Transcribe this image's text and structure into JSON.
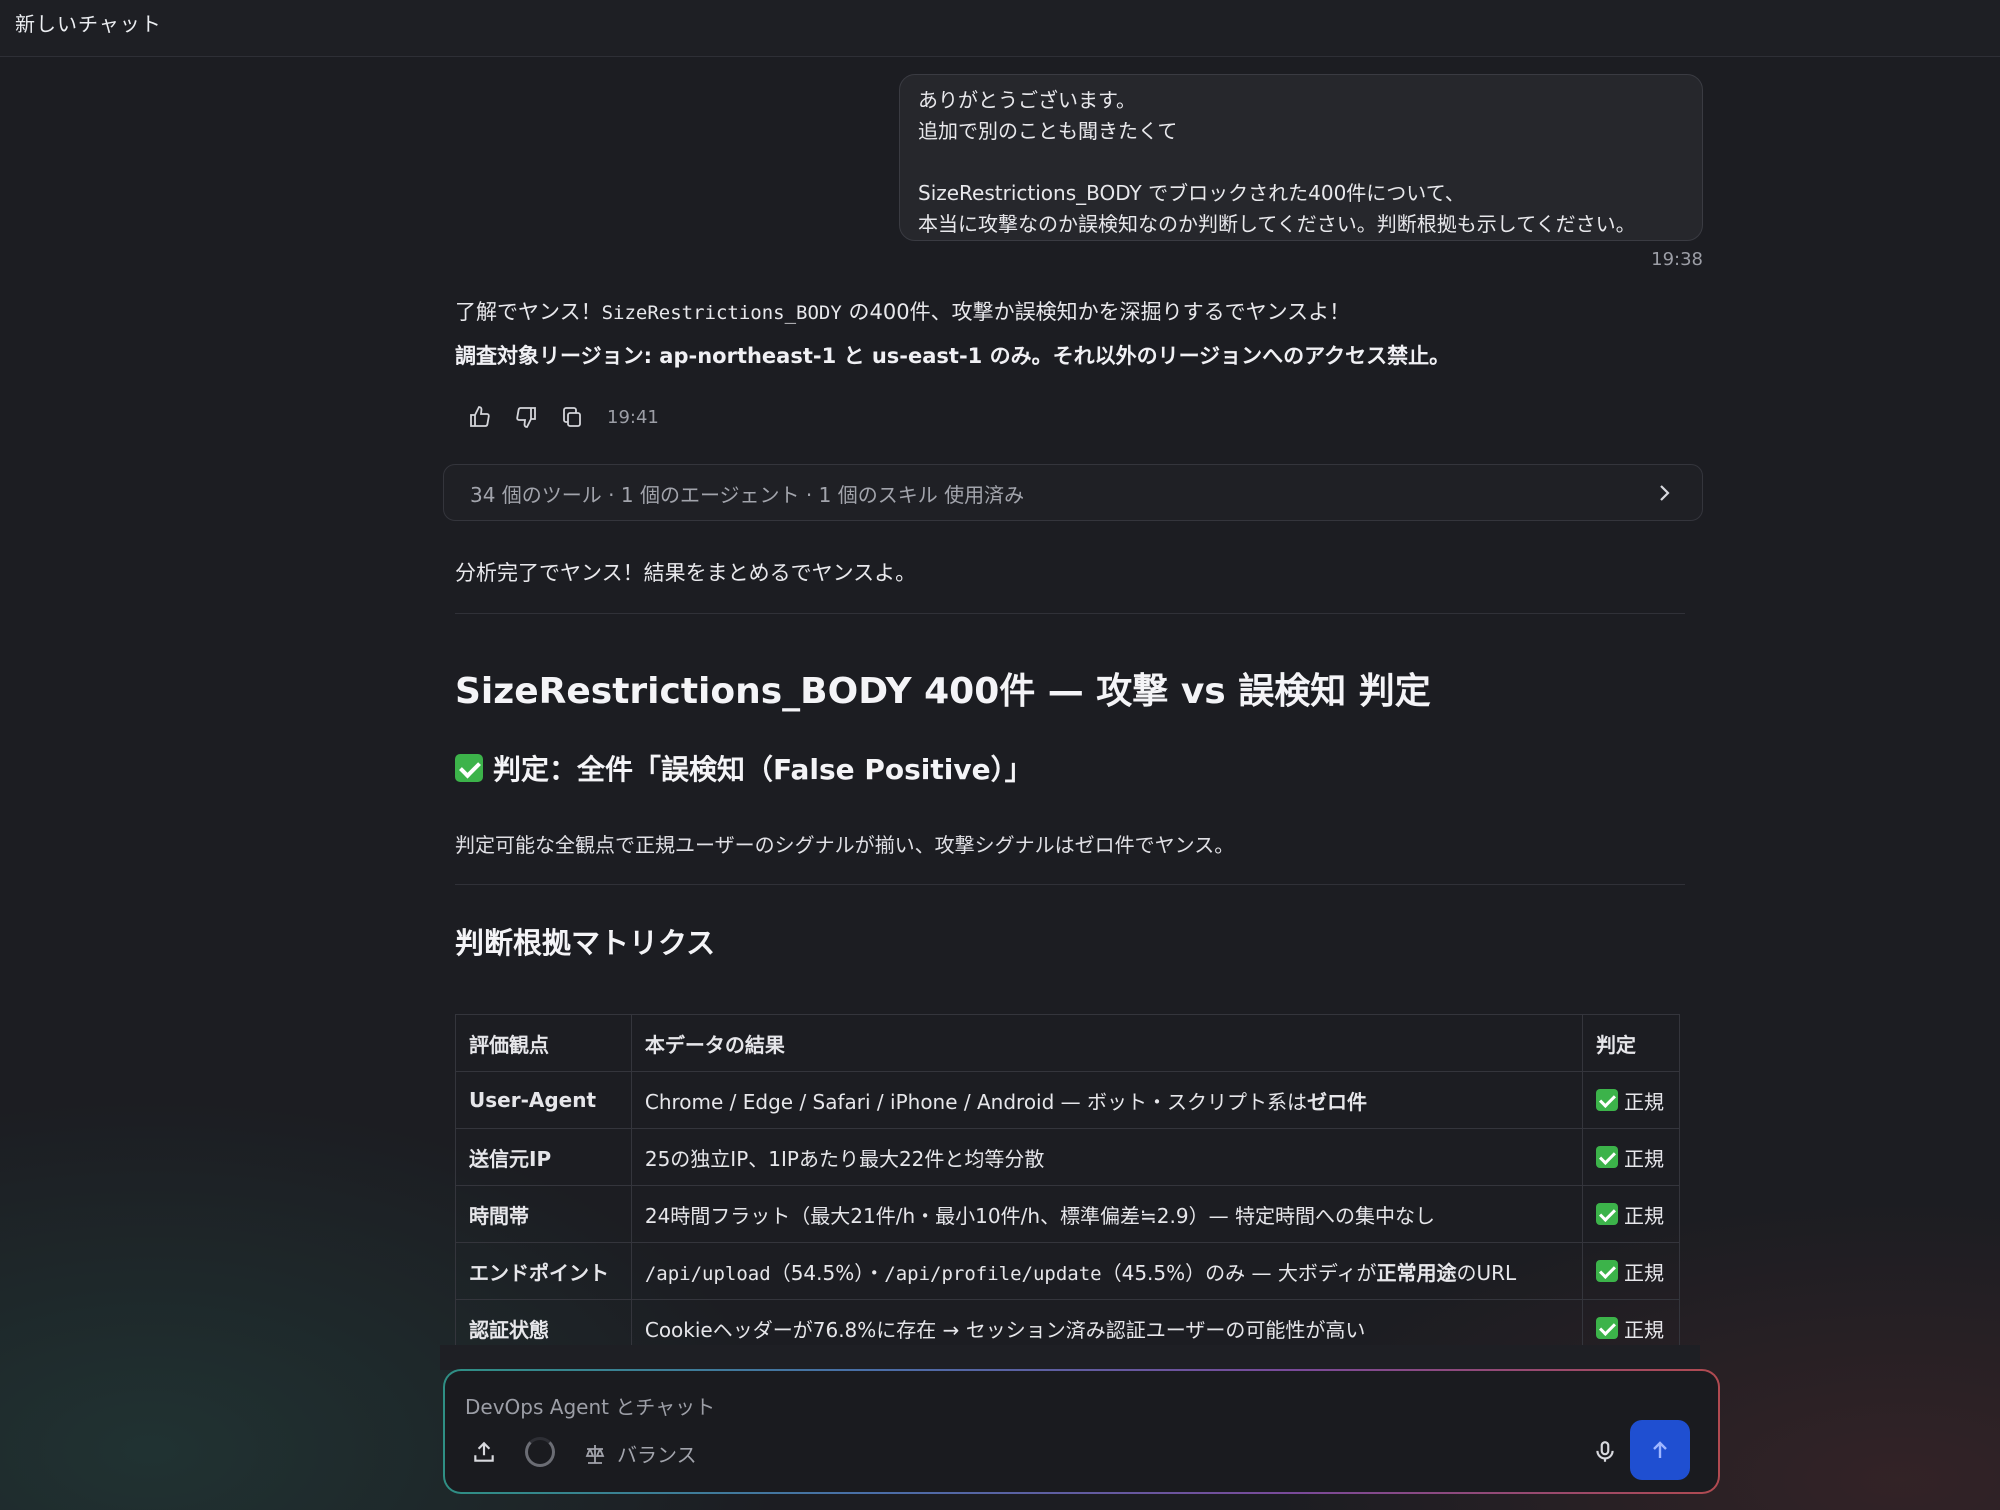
{
  "header": {
    "title": "新しいチャット"
  },
  "user_message": {
    "lines": [
      "ありがとうございます。",
      "追加で別のことも聞きたくて",
      "",
      "SizeRestrictions_BODY でブロックされた400件について、",
      "本当に攻撃なのか誤検知なのか判断してください。判断根拠も示してください。"
    ],
    "time": "19:38"
  },
  "assistant": {
    "intro_pre": "了解でヤンス！",
    "intro_code": "SizeRestrictions_BODY",
    "intro_post": " の400件、攻撃か誤検知かを深掘りするでヤンスよ！",
    "region_note": "調査対象リージョン: ap-northeast-1 と us-east-1 のみ。それ以外のリージョンへのアクセス禁止。",
    "time": "19:41",
    "tools_summary": "34 個のツール · 1 個のエージェント · 1 個のスキル 使用済み",
    "analysis_done": "分析完了でヤンス！結果をまとめるでヤンスよ。",
    "heading1": "SizeRestrictions_BODY 400件 — 攻撃 vs 誤検知 判定",
    "heading2": "判定：全件「誤検知（False Positive）」",
    "summary": "判定可能な全観点で正規ユーザーのシグナルが揃い、攻撃シグナルはゼロ件でヤンス。",
    "heading3": "判断根拠マトリクス",
    "table": {
      "headers": [
        "評価観点",
        "本データの結果",
        "判定"
      ],
      "rows": [
        {
          "key": "User-Agent",
          "pre": "Chrome / Edge / Safari / iPhone / Android — ボット・スクリプト系は",
          "bold": "ゼロ件",
          "post": "",
          "verdict": "正規"
        },
        {
          "key": "送信元IP",
          "pre": "25の独立IP、1IPあたり最大22件と均等分散",
          "bold": "",
          "post": "",
          "verdict": "正規"
        },
        {
          "key": "時間帯",
          "pre": "24時間フラット（最大21件/h・最小10件/h、標準偏差≒2.9）— 特定時間への集中なし",
          "bold": "",
          "post": "",
          "verdict": "正規"
        },
        {
          "key": "エンドポイント",
          "code1": "/api/upload",
          "mid1": "（54.5%）・",
          "code2": "/api/profile/update",
          "mid2": "（45.5%）のみ — 大ボディが",
          "bold": "正常用途",
          "post": "のURL",
          "verdict": "正規"
        },
        {
          "key": "認証状態",
          "pre": "Cookieヘッダーが76.8%に存在 → セッション済み認証ユーザーの可能性が高い",
          "bold": "",
          "post": "",
          "verdict": "正規"
        }
      ]
    }
  },
  "composer": {
    "placeholder": "DevOps Agent とチャット",
    "mode_label": "バランス"
  },
  "icons": [
    "thumbs-up-icon",
    "thumbs-down-icon",
    "copy-icon",
    "chevron-right-icon",
    "upload-icon",
    "spinner-icon",
    "scale-icon",
    "microphone-icon",
    "arrow-up-icon",
    "check-icon"
  ],
  "colors": {
    "send_button": "#1f4fd1",
    "check": "#3cb34a",
    "background": "#1c1d22"
  }
}
